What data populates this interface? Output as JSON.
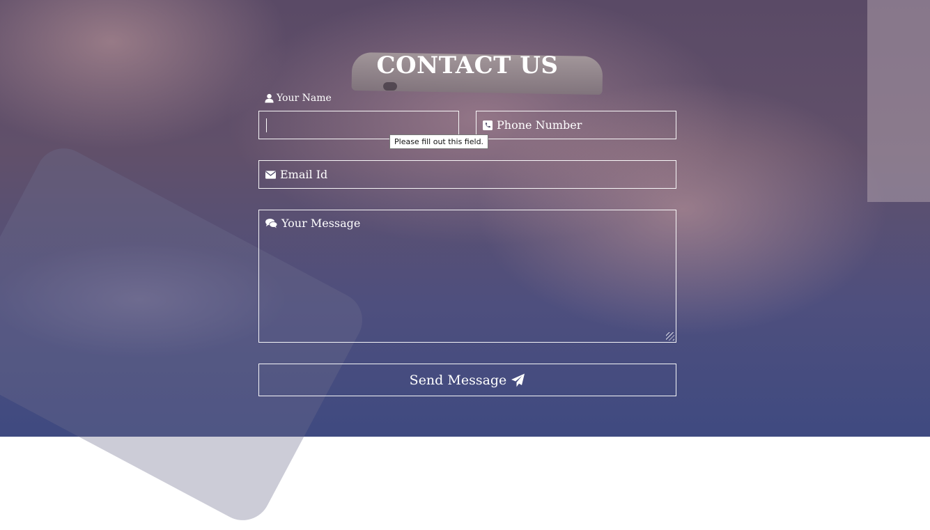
{
  "page": {
    "title": "CONTACT US",
    "colors": {
      "text": "#ffffff",
      "border": "#ffffff",
      "overlay_top": "#5a4a66",
      "overlay_bottom": "#3f4a80"
    }
  },
  "form": {
    "name_label": "Your Name",
    "name_icon": "user-icon",
    "name_value": "",
    "phone_placeholder": "Phone Number",
    "phone_icon": "phone-icon",
    "email_placeholder": "Email Id",
    "email_icon": "envelope-icon",
    "message_placeholder": "Your Message",
    "message_icon": "comments-icon",
    "send_label": "Send Message",
    "send_icon": "paper-plane-icon",
    "validation_tooltip": "Please fill out this field."
  }
}
